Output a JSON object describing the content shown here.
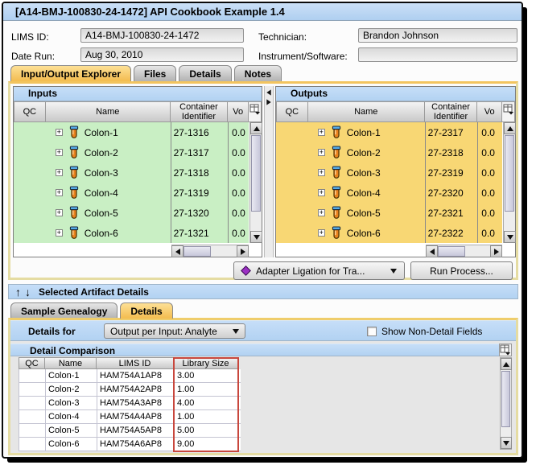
{
  "window": {
    "title": "[A14-BMJ-100830-24-1472] API Cookbook Example 1.4"
  },
  "form": {
    "lims_id": {
      "label": "LIMS ID:",
      "value": "A14-BMJ-100830-24-1472"
    },
    "technician": {
      "label": "Technician:",
      "value": "Brandon Johnson"
    },
    "date_run": {
      "label": "Date Run:",
      "value": "Aug 30, 2010"
    },
    "instrument": {
      "label": "Instrument/Software:",
      "value": ""
    }
  },
  "main_tabs": [
    {
      "label": "Input/Output Explorer",
      "selected": true
    },
    {
      "label": "Files",
      "selected": false
    },
    {
      "label": "Details",
      "selected": false
    },
    {
      "label": "Notes",
      "selected": false
    }
  ],
  "inputs_panel": {
    "title": "Inputs",
    "columns": {
      "qc": "QC",
      "name": "Name",
      "container": "Container Identifier",
      "volume": "Vo"
    },
    "rows": [
      {
        "name": "Colon-1",
        "container": "27-1316",
        "volume": "0.0"
      },
      {
        "name": "Colon-2",
        "container": "27-1317",
        "volume": "0.0"
      },
      {
        "name": "Colon-3",
        "container": "27-1318",
        "volume": "0.0"
      },
      {
        "name": "Colon-4",
        "container": "27-1319",
        "volume": "0.0"
      },
      {
        "name": "Colon-5",
        "container": "27-1320",
        "volume": "0.0"
      },
      {
        "name": "Colon-6",
        "container": "27-1321",
        "volume": "0.0"
      }
    ]
  },
  "outputs_panel": {
    "title": "Outputs",
    "columns": {
      "qc": "QC",
      "name": "Name",
      "container": "Container Identifier",
      "volume": "Vo"
    },
    "rows": [
      {
        "name": "Colon-1",
        "container": "27-2317",
        "volume": "0.0"
      },
      {
        "name": "Colon-2",
        "container": "27-2318",
        "volume": "0.0"
      },
      {
        "name": "Colon-3",
        "container": "27-2319",
        "volume": "0.0"
      },
      {
        "name": "Colon-4",
        "container": "27-2320",
        "volume": "0.0"
      },
      {
        "name": "Colon-5",
        "container": "27-2321",
        "volume": "0.0"
      },
      {
        "name": "Colon-6",
        "container": "27-2322",
        "volume": "0.0"
      }
    ]
  },
  "process": {
    "dropdown_label": "Adapter Ligation for Tra...",
    "run_button": "Run Process..."
  },
  "artifact_details": {
    "header": "Selected Artifact Details",
    "tabs": [
      {
        "label": "Sample Genealogy",
        "selected": false
      },
      {
        "label": "Details",
        "selected": true
      }
    ],
    "details_for_label": "Details for",
    "details_for_value": "Output per Input: Analyte",
    "show_non_detail_label": "Show Non-Detail Fields",
    "show_non_detail_checked": false,
    "comparison": {
      "title": "Detail Comparison",
      "columns": {
        "qc": "QC",
        "name": "Name",
        "lims_id": "LIMS ID",
        "library_size": "Library Size"
      },
      "rows": [
        {
          "qc": "",
          "name": "Colon-1",
          "lims_id": "HAM754A1AP8",
          "library_size": "3.00"
        },
        {
          "qc": "",
          "name": "Colon-2",
          "lims_id": "HAM754A2AP8",
          "library_size": "1.00"
        },
        {
          "qc": "",
          "name": "Colon-3",
          "lims_id": "HAM754A3AP8",
          "library_size": "4.00"
        },
        {
          "qc": "",
          "name": "Colon-4",
          "lims_id": "HAM754A4AP8",
          "library_size": "1.00"
        },
        {
          "qc": "",
          "name": "Colon-5",
          "lims_id": "HAM754A5AP8",
          "library_size": "5.00"
        },
        {
          "qc": "",
          "name": "Colon-6",
          "lims_id": "HAM754A6AP8",
          "library_size": "9.00"
        }
      ]
    }
  },
  "icons": {
    "tube": "test-tube-icon",
    "expand": "tree-expand-plus-icon",
    "grid": "table-options-icon",
    "diamond": "process-diamond-icon",
    "up": "move-up-icon",
    "down": "move-down-icon"
  },
  "colors": {
    "title_blue": "#B6D4F2",
    "panel_blue": "#BAD7F4",
    "inputs_green": "#C9EFC4",
    "outputs_orange": "#F8D774",
    "tab_selected_yellow": "#F5C35C",
    "highlight_red": "#C8473D"
  }
}
